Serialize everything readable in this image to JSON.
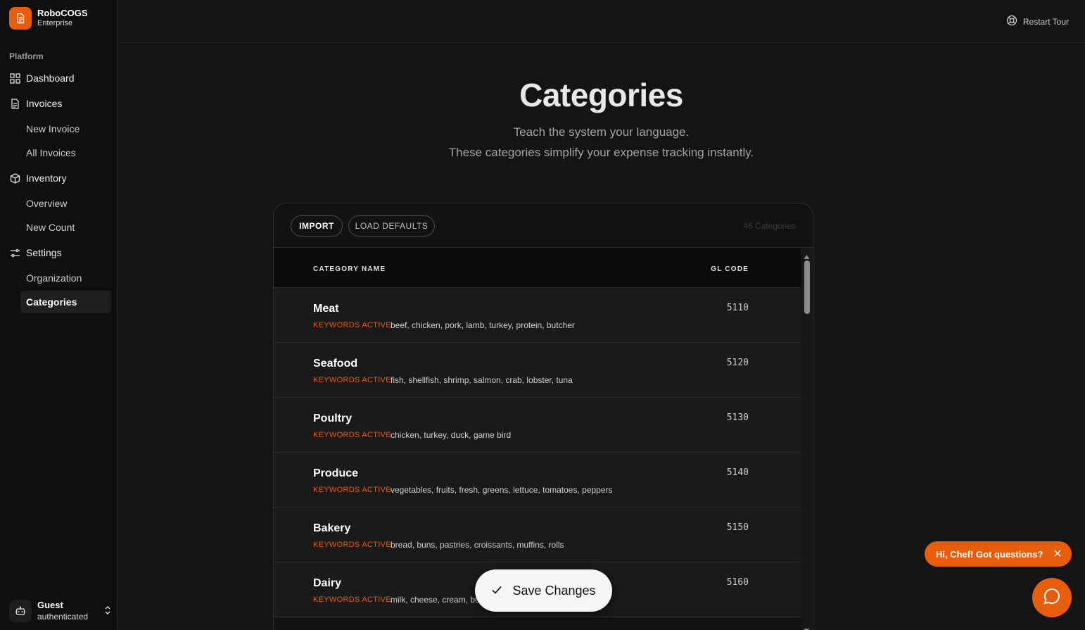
{
  "brand": {
    "name": "RoboCOGS",
    "plan": "Enterprise",
    "icon": "document-icon"
  },
  "sidebar": {
    "section": "Platform",
    "items": [
      {
        "label": "Dashboard",
        "icon": "grid-icon"
      },
      {
        "label": "Invoices",
        "icon": "document-icon"
      },
      {
        "label": "New Invoice"
      },
      {
        "label": "All Invoices"
      },
      {
        "label": "Inventory",
        "icon": "box-icon"
      },
      {
        "label": "Overview"
      },
      {
        "label": "New Count"
      },
      {
        "label": "Settings",
        "icon": "sliders-icon"
      },
      {
        "label": "Organization"
      },
      {
        "label": "Categories",
        "active": true
      }
    ]
  },
  "user": {
    "name": "Guest",
    "status": "authenticated",
    "icon": "bot-icon"
  },
  "topbar": {
    "restart_label": "Restart Tour",
    "icon": "lifebuoy-icon"
  },
  "page": {
    "title": "Categories",
    "subtitle_1": "Teach the system your language.",
    "subtitle_2": "These categories simplify your expense tracking instantly."
  },
  "toolbar": {
    "import_label": "IMPORT",
    "defaults_label": "LOAD DEFAULTS",
    "count_label": "46 Categories"
  },
  "table": {
    "columns": {
      "name": "CATEGORY NAME",
      "gl": "GL CODE"
    },
    "keyword_label": "KEYWORDS ACTIVE",
    "rows": [
      {
        "name": "Meat",
        "gl": "5110",
        "keywords": "beef, chicken, pork, lamb, turkey, protein, butcher"
      },
      {
        "name": "Seafood",
        "gl": "5120",
        "keywords": "fish, shellfish, shrimp, salmon, crab, lobster, tuna"
      },
      {
        "name": "Poultry",
        "gl": "5130",
        "keywords": "chicken, turkey, duck, game bird"
      },
      {
        "name": "Produce",
        "gl": "5140",
        "keywords": "vegetables, fruits, fresh, greens, lettuce, tomatoes, peppers"
      },
      {
        "name": "Bakery",
        "gl": "5150",
        "keywords": "bread, buns, pastries, croissants, muffins, rolls"
      },
      {
        "name": "Dairy",
        "gl": "5160",
        "keywords": "milk, cheese, cream, bu"
      }
    ]
  },
  "save": {
    "label": "Save Changes"
  },
  "chat": {
    "bubble_label": "Hi, Chef! Got questions?"
  },
  "colors": {
    "accent": "#e85d0c",
    "background": "#141414",
    "sidebar": "#0f0f0f"
  }
}
